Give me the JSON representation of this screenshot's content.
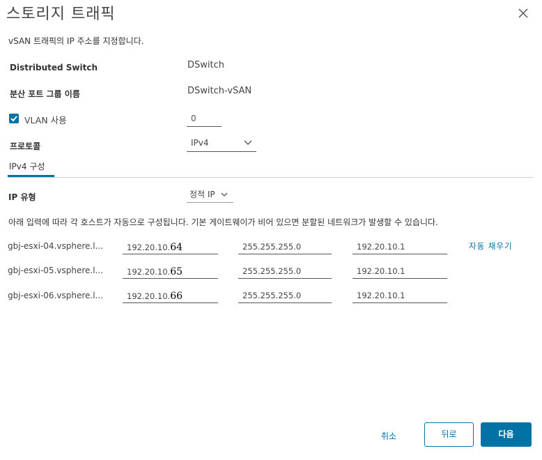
{
  "dialog": {
    "title": "스토리지 트래픽",
    "description": "vSAN 트래픽의 IP 주소를 지정합니다."
  },
  "fields": {
    "distributed_switch_label": "Distributed Switch",
    "distributed_switch_value": "DSwitch",
    "port_group_label": "분산 포트 그룹 이름",
    "port_group_value": "DSwitch-vSAN",
    "vlan_label": "VLAN 사용",
    "vlan_checked": true,
    "vlan_value": "0",
    "protocol_label": "프로토콜",
    "protocol_value": "IPv4"
  },
  "tabs": [
    {
      "label": "IPv4 구성",
      "active": true
    }
  ],
  "ip_type": {
    "label": "IP 유형",
    "value": "정적 IP"
  },
  "hint": "아래 입력에 따라 각 호스트가 자동으로 구성됩니다. 기본 게이트웨이가 비어 있으면 분할된 네트워크가 발생할 수 있습니다.",
  "hosts": [
    {
      "name": "gbj-esxi-04.vsphere.l...",
      "ip": "192.20.10.",
      "ip_overlay": "64",
      "netmask": "255.255.255.0",
      "gateway": "192.20.10.1"
    },
    {
      "name": "gbj-esxi-05.vsphere.l...",
      "ip": "192.20.10.",
      "ip_overlay": "65",
      "netmask": "255.255.255.0",
      "gateway": "192.20.10.1"
    },
    {
      "name": "gbj-esxi-06.vsphere.l...",
      "ip": "192.20.10.",
      "ip_overlay": "66",
      "netmask": "255.255.255.0",
      "gateway": "192.20.10.1"
    }
  ],
  "autofill_label": "자동 채우기",
  "footer": {
    "cancel_label": "취소",
    "back_label": "뒤로",
    "next_label": "다음"
  },
  "colors": {
    "accent": "#0072a3"
  }
}
